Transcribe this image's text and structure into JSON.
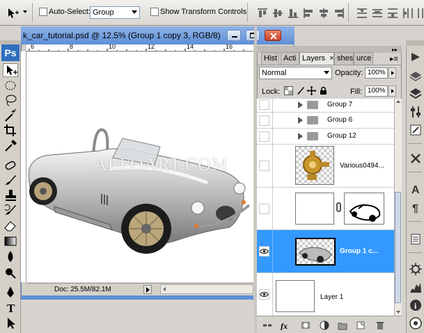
{
  "options_bar": {
    "auto_select_label": "Auto-Select:",
    "auto_select_value": "Group",
    "show_transform_label": "Show Transform Controls"
  },
  "app_logo": "Ps",
  "document": {
    "title": "k_car_tutorial.psd @ 12.5% (Group 1 copy 3, RGB/8)",
    "ruler_ticks": [
      "6",
      "8",
      "10",
      "12",
      "14",
      "16"
    ],
    "watermark": "ALFOART.COM",
    "status": "Doc: 25.5M/82.1M"
  },
  "panel": {
    "tabs": [
      "Hist",
      "Acti",
      "Layers",
      "shes",
      "urce"
    ],
    "blend_mode": "Normal",
    "opacity_label": "Opacity:",
    "opacity_value": "100%",
    "lock_label": "Lock:",
    "fill_label": "Fill:",
    "fill_value": "100%"
  },
  "layers": [
    {
      "name": "Group 7",
      "kind": "group",
      "visible": false
    },
    {
      "name": "Group 6",
      "kind": "group",
      "visible": false
    },
    {
      "name": "Group 12",
      "kind": "group",
      "visible": false
    },
    {
      "name": "Various0494...",
      "kind": "image",
      "visible": false
    },
    {
      "name": "",
      "kind": "masked",
      "visible": false
    },
    {
      "name": "Group 1 c...",
      "kind": "image",
      "visible": true,
      "selected": true
    },
    {
      "name": "Layer 1",
      "kind": "plain",
      "visible": true
    }
  ],
  "colors": {
    "selected_layer": "#3399ff",
    "title_bar": "#5f8fd6",
    "close_button": "#c6412a"
  },
  "icons": {
    "toolbox": [
      "move-tool-icon",
      "marquee-tool-icon",
      "lasso-tool-icon",
      "magic-wand-icon",
      "crop-tool-icon",
      "eyedropper-icon",
      "healing-brush-icon",
      "brush-tool-icon",
      "clone-stamp-icon",
      "history-brush-icon",
      "eraser-icon",
      "gradient-icon",
      "blur-icon",
      "dodge-icon",
      "pen-tool-icon",
      "type-tool-icon",
      "path-select-icon"
    ],
    "right_dock": [
      "play-icon",
      "layers-icon",
      "adjust-icon",
      "brush-preset-icon",
      "tools-icon",
      "text-icon",
      "paragraph-icon",
      "notes-icon",
      "settings-icon",
      "histogram-icon",
      "info-icon"
    ]
  }
}
